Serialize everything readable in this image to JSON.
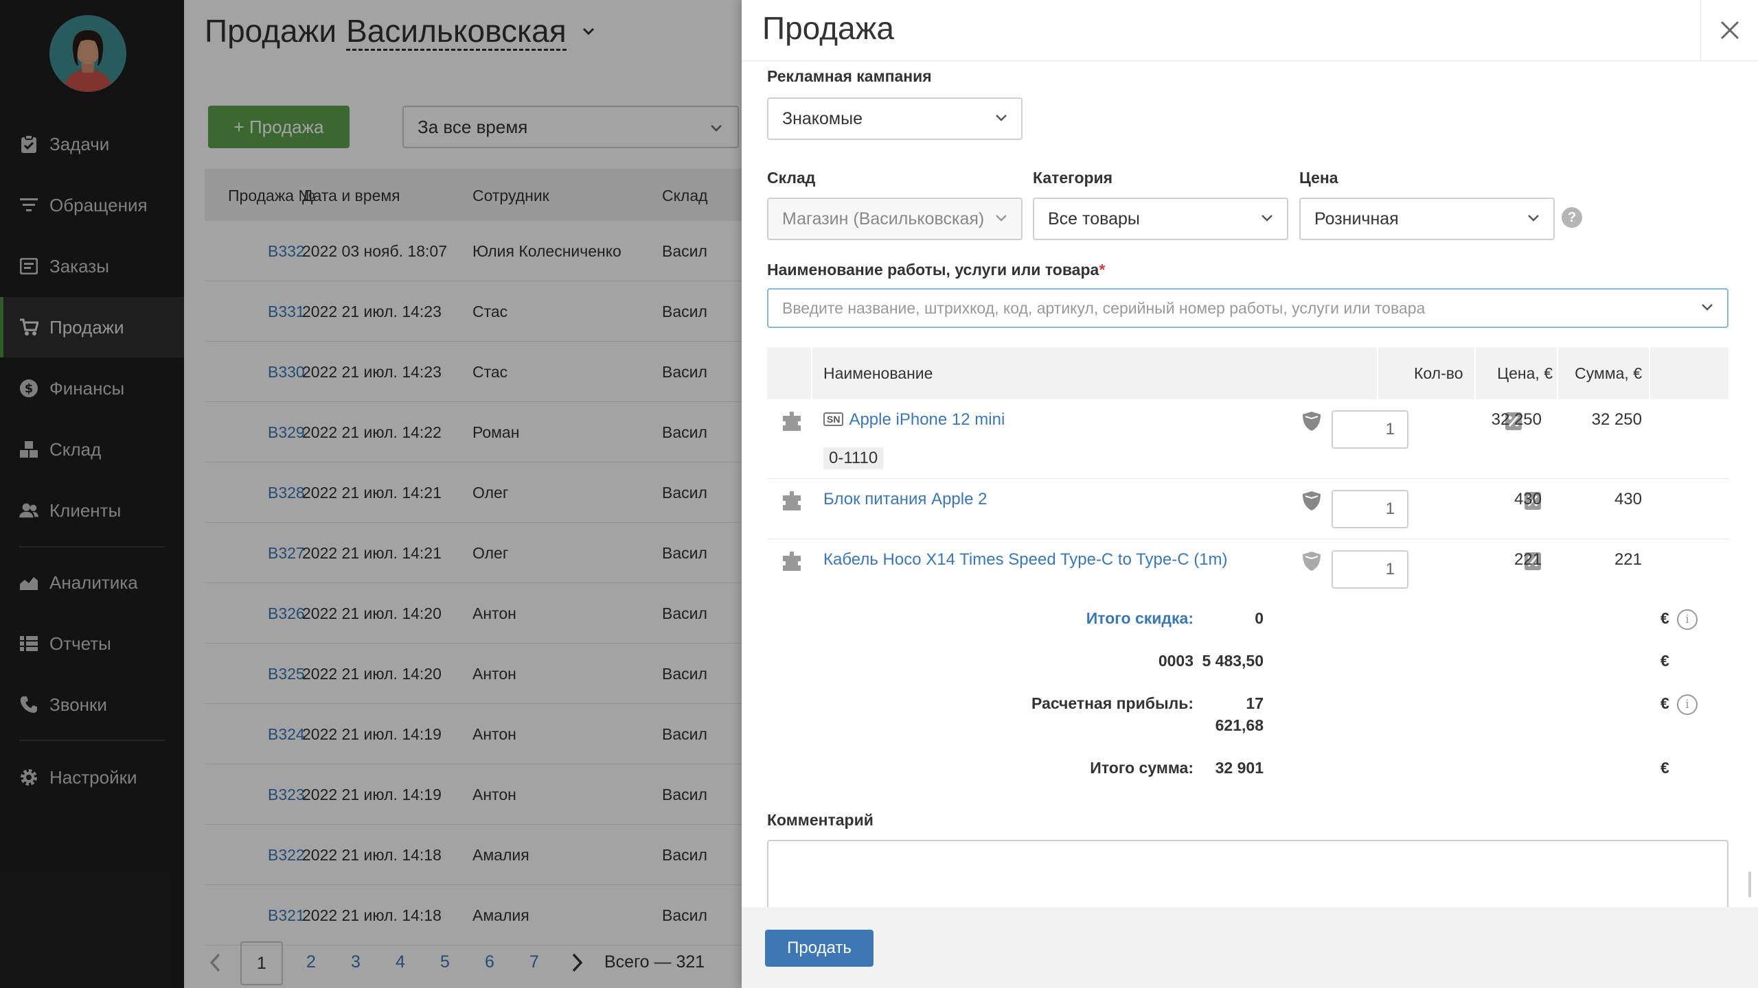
{
  "sidebar": {
    "items": [
      {
        "label": "Задачи",
        "icon": "clipboard-check-icon"
      },
      {
        "label": "Обращения",
        "icon": "filter-lines-icon"
      },
      {
        "label": "Заказы",
        "icon": "order-list-icon"
      },
      {
        "label": "Продажи",
        "icon": "cart-icon",
        "active": true
      },
      {
        "label": "Финансы",
        "icon": "dollar-circle-icon"
      },
      {
        "label": "Склад",
        "icon": "boxes-icon"
      },
      {
        "label": "Клиенты",
        "icon": "users-icon"
      },
      {
        "label": "Аналитика",
        "icon": "area-chart-icon"
      },
      {
        "label": "Отчеты",
        "icon": "table-list-icon"
      },
      {
        "label": "Звонки",
        "icon": "phone-icon"
      },
      {
        "label": "Настройки",
        "icon": "gear-icon"
      }
    ]
  },
  "main": {
    "title": "Продажи",
    "branch": "Васильковская",
    "add_button": "+ Продажа",
    "period": "За все время",
    "columns": [
      "Продажа №",
      "Дата и время",
      "Сотрудник",
      "Склад"
    ],
    "rows": [
      {
        "num": "B332",
        "date": "2022 03 нояб. 18:07",
        "employee": "Юлия Колесниченко",
        "store": "Васил"
      },
      {
        "num": "B331",
        "date": "2022 21 июл. 14:23",
        "employee": "Стас",
        "store": "Васил"
      },
      {
        "num": "B330",
        "date": "2022 21 июл. 14:23",
        "employee": "Стас",
        "store": "Васил"
      },
      {
        "num": "B329",
        "date": "2022 21 июл. 14:22",
        "employee": "Роман",
        "store": "Васил"
      },
      {
        "num": "B328",
        "date": "2022 21 июл. 14:21",
        "employee": "Олег",
        "store": "Васил"
      },
      {
        "num": "B327",
        "date": "2022 21 июл. 14:21",
        "employee": "Олег",
        "store": "Васил"
      },
      {
        "num": "B326",
        "date": "2022 21 июл. 14:20",
        "employee": "Антон",
        "store": "Васил"
      },
      {
        "num": "B325",
        "date": "2022 21 июл. 14:20",
        "employee": "Антон",
        "store": "Васил"
      },
      {
        "num": "B324",
        "date": "2022 21 июл. 14:19",
        "employee": "Антон",
        "store": "Васил"
      },
      {
        "num": "B323",
        "date": "2022 21 июл. 14:19",
        "employee": "Антон",
        "store": "Васил"
      },
      {
        "num": "B322",
        "date": "2022 21 июл. 14:18",
        "employee": "Амалия",
        "store": "Васил"
      },
      {
        "num": "B321",
        "date": "2022 21 июл. 14:18",
        "employee": "Амалия",
        "store": "Васил"
      }
    ],
    "pager": {
      "pages": [
        "1",
        "2",
        "3",
        "4",
        "5",
        "6",
        "7"
      ],
      "current": "1",
      "total": "Всего — 321"
    }
  },
  "drawer": {
    "title": "Продажа",
    "campaign_label": "Рекламная кампания",
    "campaign_value": "Знакомые",
    "store_label": "Склад",
    "store_value": "Магазин (Васильковская)",
    "category_label": "Категория",
    "category_value": "Все товары",
    "price_label": "Цена",
    "price_value": "Розничная",
    "help": "?",
    "item_label": "Наименование работы, услуги или товара",
    "item_required": "*",
    "item_placeholder": "Введите название, штрихкод, код, артикул, серийный номер работы, услуги или товара",
    "table_headers": {
      "name": "Наименование",
      "qty": "Кол-во",
      "price": "Цена, €",
      "sum": "Сумма, €"
    },
    "items": [
      {
        "sn_badge": "SN",
        "name": "Apple iPhone 12 mini",
        "serial": "0-1110",
        "qty": "1",
        "price": "32 250",
        "sum": "32 250"
      },
      {
        "name": "Блок питания Apple 2",
        "qty": "1",
        "price": "430",
        "sum": "430"
      },
      {
        "name": "Кабель Hoco X14 Times Speed Type-C to Type-C (1m)",
        "qty": "1",
        "price": "221",
        "sum": "221"
      }
    ],
    "totals": {
      "discount_label": "Итого скидка:",
      "discount_value": "0",
      "code_label": "0003",
      "code_value": "5 483,50",
      "profit_label": "Расчетная прибыль:",
      "profit_value_1": "17",
      "profit_value_2": "621,68",
      "total_label": "Итого сумма:",
      "total_value": "32 901",
      "currency": "€",
      "info": "i"
    },
    "comment_label": "Комментарий",
    "sell_button": "Продать"
  },
  "colors": {
    "sidebar_bg": "#1f1f1f",
    "accent_green": "#5da14b",
    "link_blue": "#3a78b5",
    "required_red": "#d63b3b"
  }
}
